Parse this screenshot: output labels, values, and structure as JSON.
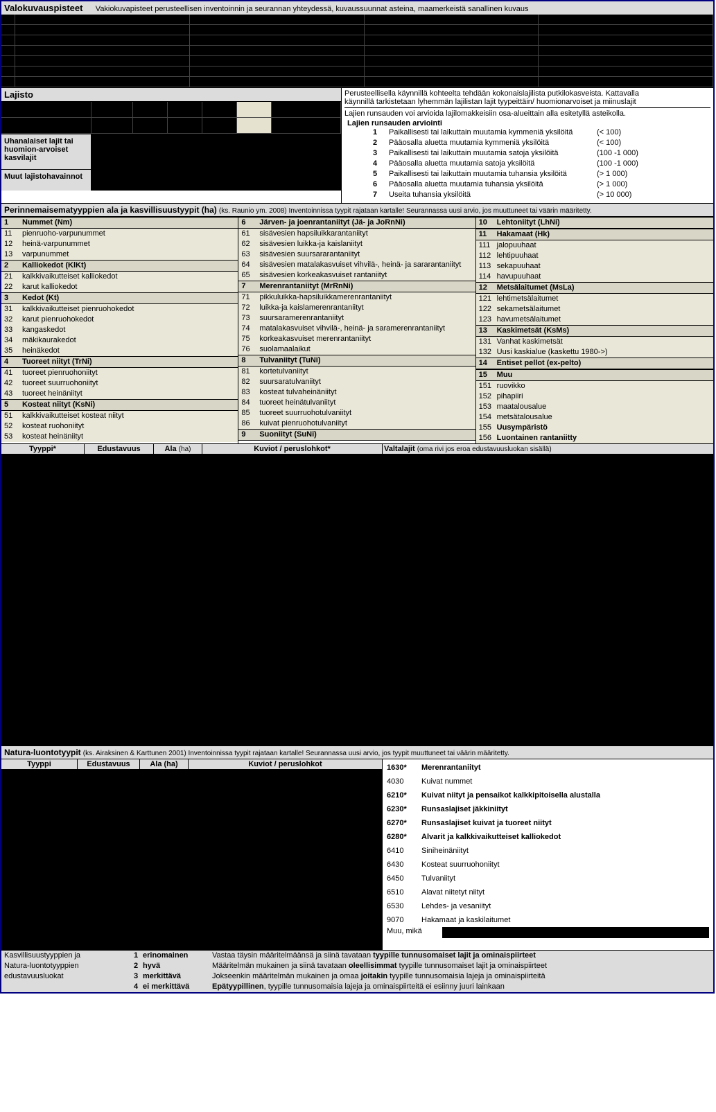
{
  "valokuvauspisteet": {
    "title": "Valokuvauspisteet",
    "desc": "Vakiokuvapisteet perusteellisen inventoinnin ja seurannan yhteydessä, kuvaussuunnat asteina, maamerkeistä sanallinen kuvaus"
  },
  "lajisto": {
    "title": "Lajisto",
    "desc1": "Perusteellisella käynnillä kohteelta tehdään kokonaislajilista putkilokasveista. Kattavalla",
    "desc2": "käynnillä tarkistetaan lyhemmän lajilistan lajit tyypeittäin/ huomionarvoiset ja miinuslajit",
    "desc3": "Lajien runsauden voi arvioida lajilomakkeisiin osa-alueittain alla esitetyllä asteikolla.",
    "uhanalaiset_label": "Uhanalaiset lajit tai huomion-arvoiset kasvilajit",
    "muut_label": "Muut lajistohavainnot",
    "runsaus_title": "Lajien runsauden arviointi",
    "runsaus": [
      {
        "n": "1",
        "t": "Paikallisesti tai laikuttain muutamia kymmeniä yksilöitä",
        "q": "(< 100)"
      },
      {
        "n": "2",
        "t": "Pääosalla aluetta muutamia kymmeniä yksilöitä",
        "q": "(< 100)"
      },
      {
        "n": "3",
        "t": "Paikallisesti tai laikuttain muutamia satoja yksilöitä",
        "q": "(100 -1 000)"
      },
      {
        "n": "4",
        "t": "Pääosalla aluetta muutamia satoja yksilöitä",
        "q": "(100 -1 000)"
      },
      {
        "n": "5",
        "t": "Paikallisesti tai laikuttain muutamia tuhansia yksilöitä",
        "q": "(> 1 000)"
      },
      {
        "n": "6",
        "t": "Pääosalla aluetta muutamia tuhansia yksilöitä",
        "q": "(> 1 000)"
      },
      {
        "n": "7",
        "t": "Useita tuhansia yksilöitä",
        "q": "(> 10 000)"
      }
    ]
  },
  "perinne": {
    "title": "Perinnemaisematyyppien ala ja kasvillisuustyypit (ha)",
    "note": "(ks. Raunio ym. 2008) Inventoinnissa tyypit rajataan kartalle! Seurannassa uusi arvio, jos muuttuneet tai väärin määritetty.",
    "col1": [
      {
        "c": "1",
        "t": "Nummet (Nm)",
        "m": true
      },
      {
        "c": "11",
        "t": "pienruoho-varpunummet"
      },
      {
        "c": "12",
        "t": "heinä-varpunummet"
      },
      {
        "c": "13",
        "t": "varpunummet"
      },
      {
        "c": "2",
        "t": "Kalliokedot (KlKt)",
        "m": true
      },
      {
        "c": "21",
        "t": "kalkkivaikutteiset kalliokedot"
      },
      {
        "c": "22",
        "t": "karut kalliokedot"
      },
      {
        "c": "3",
        "t": "Kedot (Kt)",
        "m": true
      },
      {
        "c": "31",
        "t": "kalkkivaikutteiset pienruohokedot"
      },
      {
        "c": "32",
        "t": "karut pienruohokedot"
      },
      {
        "c": "33",
        "t": "kangaskedot"
      },
      {
        "c": "34",
        "t": "mäkikaurakedot"
      },
      {
        "c": "35",
        "t": "heinäkedot"
      },
      {
        "c": "4",
        "t": "Tuoreet niityt (TrNi)",
        "m": true
      },
      {
        "c": "41",
        "t": "tuoreet pienruohoniityt"
      },
      {
        "c": "42",
        "t": "tuoreet suurruohoniityt"
      },
      {
        "c": "43",
        "t": "tuoreet heinäniityt"
      },
      {
        "c": "5",
        "t": "Kosteat niityt (KsNi)",
        "m": true
      },
      {
        "c": "51",
        "t": "kalkkivaikutteiset kosteat niityt"
      },
      {
        "c": "52",
        "t": "kosteat ruohoniityt"
      },
      {
        "c": "53",
        "t": "kosteat heinäniityt"
      }
    ],
    "col2": [
      {
        "c": "6",
        "t": "Järven- ja joenrantaniityt (Jä- ja JoRnNi)",
        "m": true
      },
      {
        "c": "61",
        "t": "sisävesien hapsiluikkarantaniityt"
      },
      {
        "c": "62",
        "t": "sisävesien luikka-ja kaislaniityt"
      },
      {
        "c": "63",
        "t": "sisävesien suursararantaniityt"
      },
      {
        "c": "64",
        "t": "sisävesien matalakasvuiset vihvilä-, heinä- ja sararantaniityt"
      },
      {
        "c": "65",
        "t": "sisävesien korkeakasvuiset rantaniityt"
      },
      {
        "c": "7",
        "t": "Merenrantaniityt (MrRnNi)",
        "m": true
      },
      {
        "c": "71",
        "t": "pikkuluikka-hapsiluikkamerenrantaniityt"
      },
      {
        "c": "72",
        "t": "luikka-ja kaislamerenrantaniityt"
      },
      {
        "c": "73",
        "t": "suursaramerenrantaniityt"
      },
      {
        "c": "74",
        "t": "matalakasvuiset vihvilä-, heinä- ja saramerenrantaniityt"
      },
      {
        "c": "75",
        "t": "korkeakasvuiset merenrantaniityt"
      },
      {
        "c": "76",
        "t": "suolamaalaikut"
      },
      {
        "c": "8",
        "t": "Tulvaniityt (TuNi)",
        "m": true
      },
      {
        "c": "81",
        "t": "kortetulvaniityt"
      },
      {
        "c": "82",
        "t": "suursaratulvaniityt"
      },
      {
        "c": "83",
        "t": "kosteat tulvaheinäniityt"
      },
      {
        "c": "84",
        "t": "tuoreet heinätulvaniityt"
      },
      {
        "c": "85",
        "t": "tuoreet suurruohotulvaniityt"
      },
      {
        "c": "86",
        "t": "kuivat pienruohotulvaniityt"
      },
      {
        "c": "9",
        "t": "Suoniityt (SuNi)",
        "m": true
      }
    ],
    "col3": [
      {
        "c": "10",
        "t": "Lehtoniityt (LhNi)",
        "m": true
      },
      {
        "c": "11",
        "t": "Hakamaat (Hk)",
        "m": true
      },
      {
        "c": "111",
        "t": "jalopuuhaat"
      },
      {
        "c": "112",
        "t": "lehtipuuhaat"
      },
      {
        "c": "113",
        "t": "sekapuuhaat"
      },
      {
        "c": "114",
        "t": "havupuuhaat"
      },
      {
        "c": "12",
        "t": "Metsälaitumet (MsLa)",
        "m": true
      },
      {
        "c": "121",
        "t": "lehtimetsälaitumet"
      },
      {
        "c": "122",
        "t": "sekametsälaitumet"
      },
      {
        "c": "123",
        "t": "havumetsälaitumet"
      },
      {
        "c": "13",
        "t": "Kaskimetsät (KsMs)",
        "m": true
      },
      {
        "c": "131",
        "t": "Vanhat kaskimetsät"
      },
      {
        "c": "132",
        "t": "Uusi kaskialue (kaskettu 1980->)"
      },
      {
        "c": "14",
        "t": "Entiset pellot (ex-pelto)",
        "m": true
      },
      {
        "c": "15",
        "t": "Muu",
        "m": true
      },
      {
        "c": "151",
        "t": "ruovikko"
      },
      {
        "c": "152",
        "t": "pihapiiri"
      },
      {
        "c": "153",
        "t": "maatalousalue"
      },
      {
        "c": "154",
        "t": "metsätalousalue"
      },
      {
        "c": "155",
        "t": "Uusympäristö",
        "b": true
      },
      {
        "c": "156",
        "t": "Luontainen rantaniitty",
        "b": true
      }
    ],
    "entry_headers": {
      "tyyppi": "Tyyppi*",
      "edustavuus": "Edustavuus",
      "ala": "Ala",
      "ala_unit": "(ha)",
      "kuviot": "Kuviot / peruslohkot*",
      "valtalajit": "Valtalajit",
      "valtalajit_note": "(oma rivi jos eroa edustavuusluokan sisällä)"
    }
  },
  "natura": {
    "title": "Natura-luontotyypit",
    "note": "(ks. Airaksinen & Karttunen 2001)  Inventoinnissa tyypit rajataan kartalle! Seurannassa uusi arvio, jos tyypit muuttuneet tai väärin määritetty.",
    "headers": {
      "tyyppi": "Tyyppi",
      "edustavuus": "Edustavuus",
      "ala": "Ala (ha)",
      "kuviot": "Kuviot / peruslohkot"
    },
    "list": [
      {
        "code": "1630*",
        "t": "Merenrantaniityt",
        "b": true
      },
      {
        "code": "4030",
        "t": "Kuivat nummet"
      },
      {
        "code": "6210*",
        "t": "Kuivat niityt ja pensaikot kalkkipitoisella alustalla",
        "b": true
      },
      {
        "code": "6230*",
        "t": "Runsaslajiset jäkkiniityt",
        "b": true
      },
      {
        "code": "6270*",
        "t": "Runsaslajiset kuivat ja tuoreet niityt",
        "b": true
      },
      {
        "code": "6280*",
        "t": "Alvarit ja kalkkivaikutteiset kalliokedot",
        "b": true
      },
      {
        "code": "6410",
        "t": "Siniheinäniityt"
      },
      {
        "code": "6430",
        "t": "Kosteat suurruohoniityt"
      },
      {
        "code": "6450",
        "t": "Tulvaniityt"
      },
      {
        "code": "6510",
        "t": "Alavat niitetyt niityt"
      },
      {
        "code": "6530",
        "t": "Lehdes- ja vesaniityt"
      },
      {
        "code": "9070",
        "t": "Hakamaat ja kaskilaitumet"
      }
    ],
    "muu": "Muu, mikä"
  },
  "edustavuus": {
    "title": "Kasvillisuustyyppien ja Natura-luontotyyppien edustavuusluokat",
    "rows": [
      {
        "n": "1",
        "t": "erinomainen",
        "d": "Vastaa täysin määritelmäänsä ja siinä tavataan <b>tyypille tunnusomaiset lajit ja ominaispiirteet</b>"
      },
      {
        "n": "2",
        "t": "hyvä",
        "d": "Määritelmän mukainen ja siinä tavataan <b>oleellisimmat</b> tyypille tunnusomaiset lajit ja ominaispiirteet"
      },
      {
        "n": "3",
        "t": "merkittävä",
        "d": "Jokseenkin määritelmän mukainen ja omaa <b>joitakin</b> tyypille tunnusomaisia lajeja ja ominaispiirteitä"
      },
      {
        "n": "4",
        "t": "ei merkittävä",
        "d": "<b>Epätyypillinen</b>, tyypille tunnusomaisia lajeja ja ominaispiirteitä ei esiinny juuri lainkaan"
      }
    ]
  }
}
